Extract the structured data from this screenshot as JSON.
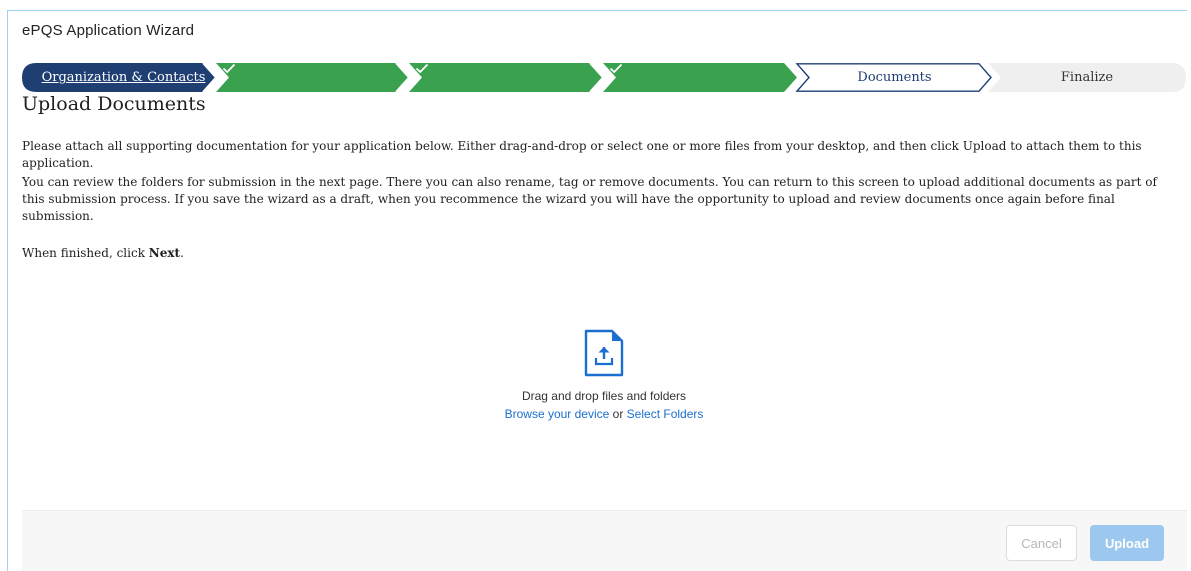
{
  "window": {
    "title": "ePQS Application Wizard"
  },
  "steps": [
    {
      "label": "Organization & Contacts",
      "state": "link"
    },
    {
      "label": "",
      "state": "done",
      "icon": "check-icon"
    },
    {
      "label": "",
      "state": "done",
      "icon": "check-icon"
    },
    {
      "label": "",
      "state": "done",
      "icon": "check-icon"
    },
    {
      "label": "Documents",
      "state": "current"
    },
    {
      "label": "Finalize",
      "state": "future"
    }
  ],
  "colors": {
    "navy": "#1f3f73",
    "green": "#3aa14f",
    "current_border": "#1f3f73",
    "future_bg": "#efefef",
    "link": "#1b6fd1"
  },
  "page": {
    "title": "Upload Documents",
    "paragraph1": "Please attach all supporting documentation for your application below. Either drag-and-drop or select one or more files from your desktop, and then click Upload to attach them to this application.",
    "paragraph2": "You can review the folders for submission in the next page. There you can also rename, tag or remove documents. You can return to this screen to upload additional documents as part of this submission process. If you save the wizard as a draft, when you recommence the wizard you will have the opportunity to upload and review documents once again before final submission.",
    "finish_prefix": "When finished, click ",
    "finish_bold": "Next",
    "finish_suffix": "."
  },
  "dropzone": {
    "icon": "file-upload-icon",
    "text": "Drag and drop files and folders",
    "browse_link": "Browse your device",
    "or_text": " or ",
    "folders_link": "Select Folders"
  },
  "footer": {
    "cancel_label": "Cancel",
    "upload_label": "Upload"
  }
}
